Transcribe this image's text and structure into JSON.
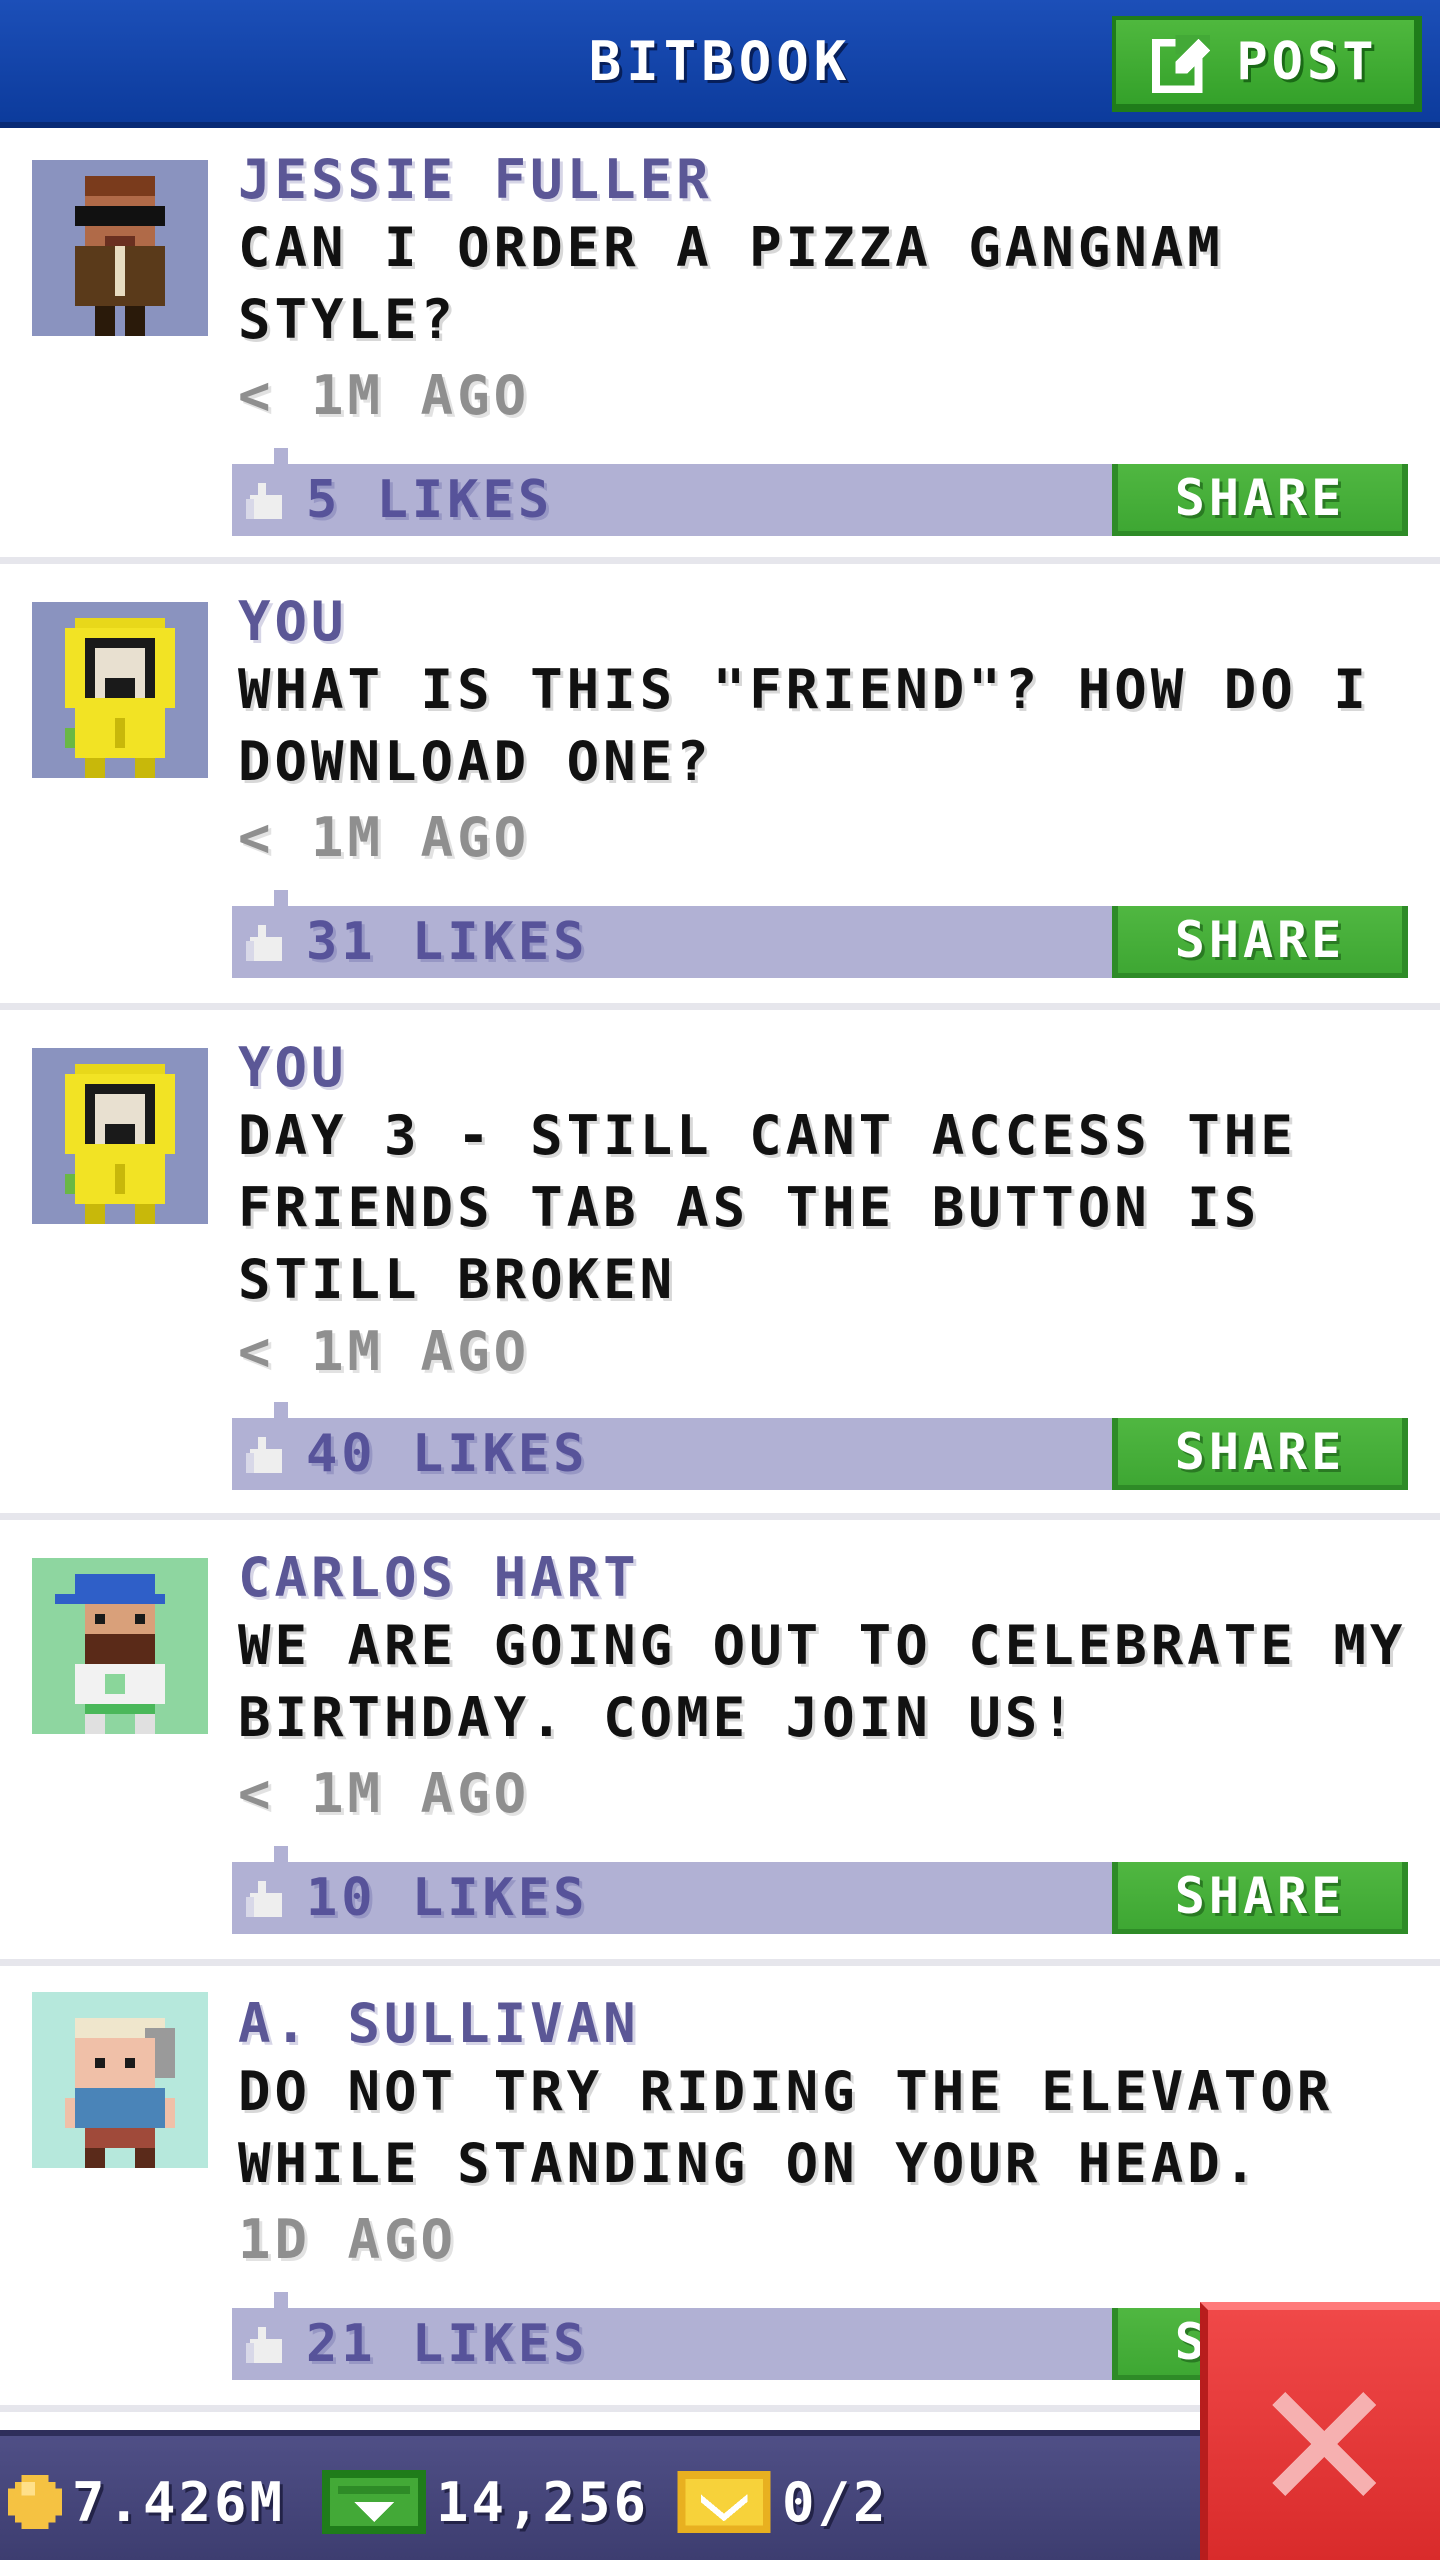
{
  "header": {
    "title": "BITBOOK",
    "post_label": "POST"
  },
  "posts": [
    {
      "author": "JESSIE FULLER",
      "message": "CAN I ORDER A PIZZA GANGNAM STYLE?",
      "time": "< 1M AGO",
      "likes": "5 LIKES",
      "share_label": "SHARE",
      "avatar_bg": "#8a93bf"
    },
    {
      "author": "YOU",
      "message": "WHAT IS THIS \"FRIEND\"? HOW DO I DOWNLOAD ONE?",
      "time": "< 1M AGO",
      "likes": "31 LIKES",
      "share_label": "SHARE",
      "avatar_bg": "#8a93bf"
    },
    {
      "author": "YOU",
      "message": "DAY 3 - STILL CANT ACCESS THE FRIENDS TAB AS THE BUTTON IS STILL BROKEN",
      "time": "< 1M AGO",
      "likes": "40 LIKES",
      "share_label": "SHARE",
      "avatar_bg": "#8a93bf"
    },
    {
      "author": "CARLOS HART",
      "message": "WE ARE GOING OUT TO CELEBRATE MY BIRTHDAY. COME JOIN US!",
      "time": "< 1M AGO",
      "likes": "10 LIKES",
      "share_label": "SHARE",
      "avatar_bg": "#8ed6a0"
    },
    {
      "author": "A. SULLIVAN",
      "message": "DO NOT TRY RIDING THE ELEVATOR WHILE STANDING ON YOUR HEAD.",
      "time": "1D AGO",
      "likes": "21 LIKES",
      "share_label": "SHARE",
      "avatar_bg": "#b6e8dc"
    }
  ],
  "status_bar": {
    "coins": "7.426M",
    "bux": "14,256",
    "tickets": "0/2"
  },
  "colors": {
    "header_blue": "#1c4fb8",
    "button_green": "#43a937",
    "like_bar": "#b1b1d4",
    "author_purple": "#5b5796",
    "close_red": "#e33a3a"
  },
  "icons": {
    "post": "edit-icon",
    "likes": "thumbs-up-icon",
    "coins": "coin-icon",
    "bux": "bux-icon",
    "tickets": "ticket-icon",
    "close": "close-icon"
  }
}
